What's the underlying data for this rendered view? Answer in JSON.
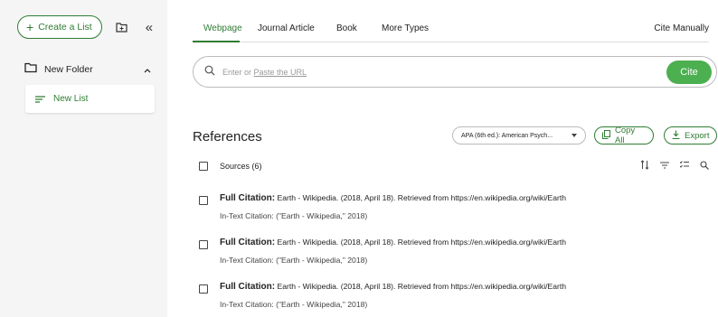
{
  "sidebar": {
    "create_label": "Create a List",
    "folder": {
      "label": "New Folder"
    },
    "list": {
      "label": "New List"
    }
  },
  "tabs": [
    "Webpage",
    "Journal Article",
    "Book",
    "More Types"
  ],
  "cite_manually": "Cite Manually",
  "search": {
    "prefix": "Enter or ",
    "link": "Paste the URL",
    "button": "Cite"
  },
  "references": {
    "title": "References",
    "style_selected": "APA (6th ed.): American Psych...",
    "copy_all": "Copy All",
    "export": "Export",
    "sources_label": "Sources (6)"
  },
  "citations": [
    {
      "label": "Full Citation:",
      "text": " Earth - Wikipedia. (2018, April 18). Retrieved from https://en.wikipedia.org/wiki/Earth",
      "intext": "In-Text Citation: (\"Earth - Wikipedia,\" 2018)"
    },
    {
      "label": "Full Citation:",
      "text": " Earth - Wikipedia. (2018, April 18). Retrieved from https://en.wikipedia.org/wiki/Earth",
      "intext": "In-Text Citation: (\"Earth - Wikipedia,\" 2018)"
    },
    {
      "label": "Full Citation:",
      "text": " Earth - Wikipedia. (2018, April 18). Retrieved from https://en.wikipedia.org/wiki/Earth",
      "intext": "In-Text Citation: (\"Earth - Wikipedia,\" 2018)"
    }
  ],
  "colors": {
    "accent": "#2e7d32",
    "cite_button": "#4caf50",
    "sidebar_bg": "#f5f5f5"
  },
  "icons": [
    "plus-icon",
    "new-folder-icon",
    "collapse-icon",
    "folder-icon",
    "chevron-up-icon",
    "list-icon",
    "search-icon",
    "copy-icon",
    "download-icon",
    "sort-icon",
    "filter-icon",
    "checklist-icon"
  ]
}
